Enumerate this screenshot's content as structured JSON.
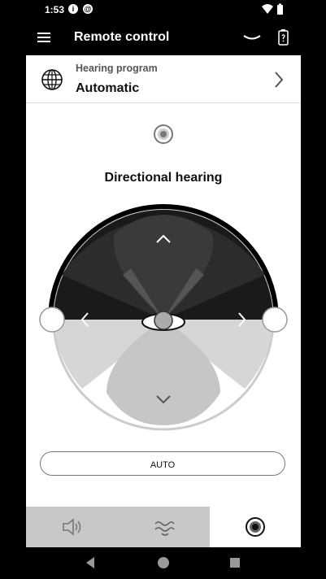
{
  "status_bar": {
    "time": "1:53",
    "icons": [
      "info-icon",
      "sync-icon",
      "wifi-icon",
      "battery-icon"
    ]
  },
  "app_bar": {
    "title": "Remote control",
    "icons": [
      "menu-icon",
      "chevron-down-icon",
      "hearing-aid-battery-icon"
    ]
  },
  "hearing_program": {
    "label": "Hearing program",
    "value": "Automatic",
    "icon": "globe-icon"
  },
  "directional": {
    "title": "Directional hearing",
    "mode_icon": "target-icon"
  },
  "auto_button": {
    "label": "AUTO"
  },
  "bottom_nav": {
    "tabs": [
      {
        "name": "volume",
        "icon": "speaker-icon",
        "selected": false
      },
      {
        "name": "sound",
        "icon": "waves-icon",
        "selected": false
      },
      {
        "name": "directional",
        "icon": "target-icon",
        "selected": true
      }
    ]
  },
  "system_nav": {
    "buttons": [
      "back-icon",
      "home-icon",
      "recents-icon"
    ]
  },
  "colors": {
    "app_bar": "#000000",
    "content": "#ffffff",
    "dial_dark": "#1a1a1a",
    "dial_light": "#d0d0d0",
    "nav_inactive": "#c8c8c8"
  }
}
